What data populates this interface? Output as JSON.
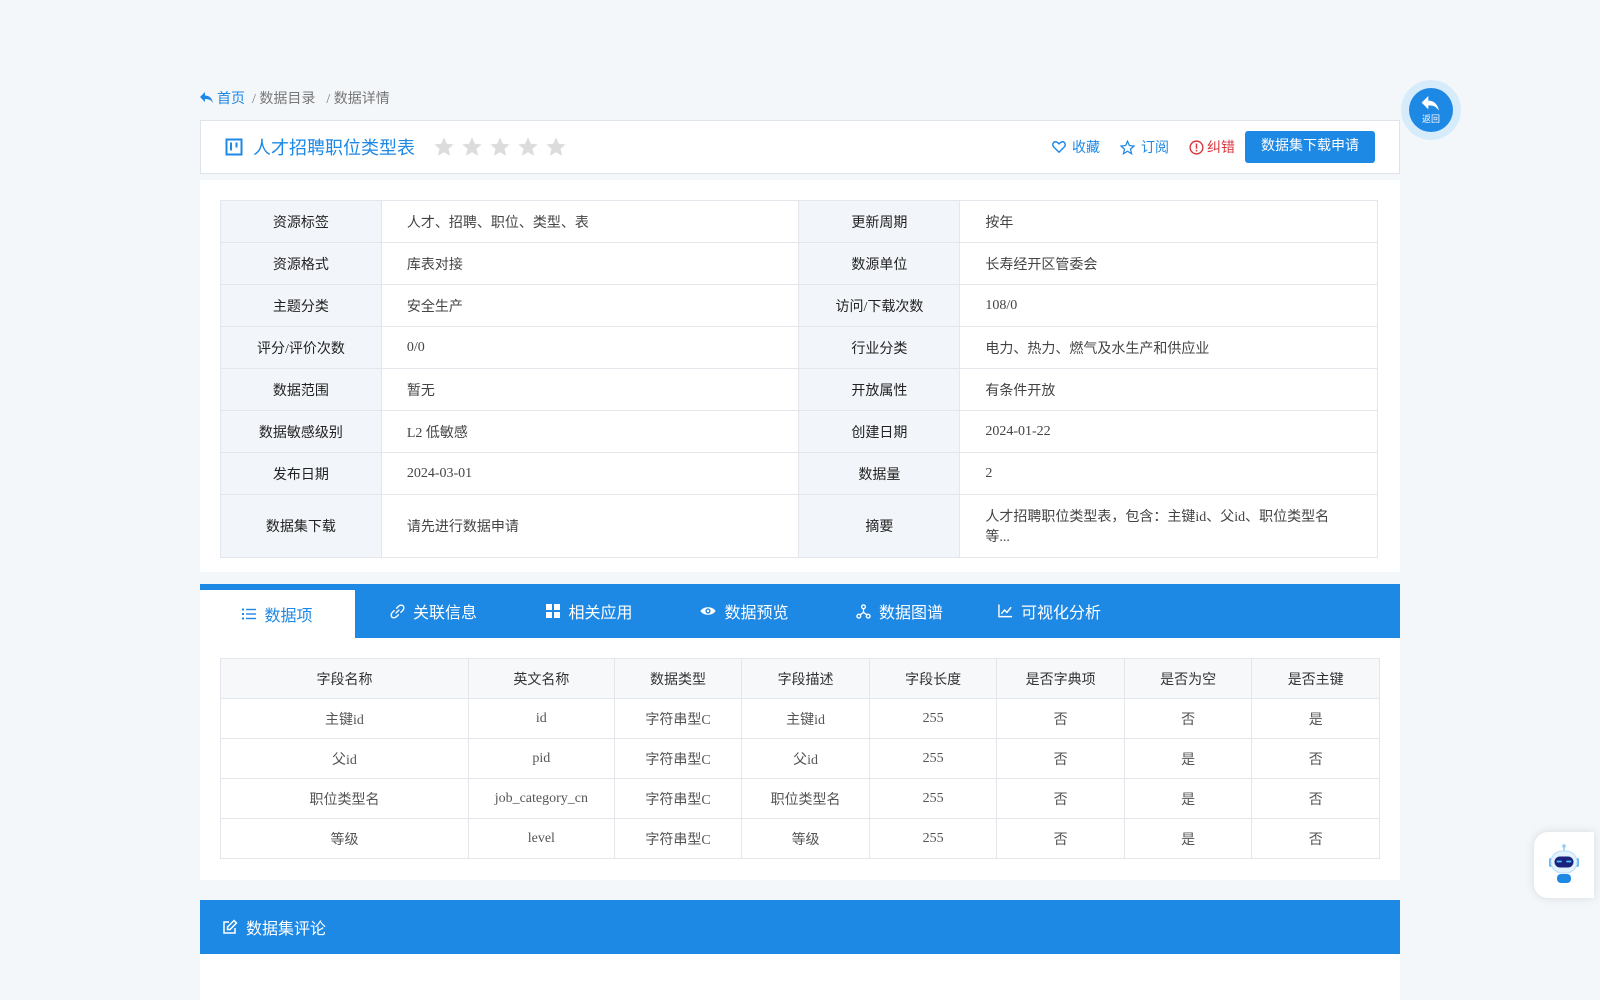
{
  "breadcrumb": {
    "home": "首页",
    "catalog": "/ 数据目录",
    "detail": "/ 数据详情"
  },
  "title_bar": {
    "title": "人才招聘职位类型表",
    "rating_stars": 0,
    "rating_max": 5,
    "favorite": "收藏",
    "subscribe": "订阅",
    "report": "纠错",
    "apply_download": "数据集下载申请"
  },
  "info": {
    "rows": [
      [
        {
          "label": "资源标签",
          "value": "人才、招聘、职位、类型、表"
        },
        {
          "label": "更新周期",
          "value": "按年"
        }
      ],
      [
        {
          "label": "资源格式",
          "value": "库表对接"
        },
        {
          "label": "数源单位",
          "value": "长寿经开区管委会"
        }
      ],
      [
        {
          "label": "主题分类",
          "value": "安全生产"
        },
        {
          "label": "访问/下载次数",
          "value": "108/0"
        }
      ],
      [
        {
          "label": "评分/评价次数",
          "value": "0/0"
        },
        {
          "label": "行业分类",
          "value": "电力、热力、燃气及水生产和供应业"
        }
      ],
      [
        {
          "label": "数据范围",
          "value": "暂无"
        },
        {
          "label": "开放属性",
          "value": "有条件开放"
        }
      ],
      [
        {
          "label": "数据敏感级别",
          "value": "L2 低敏感"
        },
        {
          "label": "创建日期",
          "value": "2024-01-22"
        }
      ],
      [
        {
          "label": "发布日期",
          "value": "2024-03-01"
        },
        {
          "label": "数据量",
          "value": "2"
        }
      ],
      [
        {
          "label": "数据集下载",
          "value": "请先进行数据申请"
        },
        {
          "label": "摘要",
          "value": "人才招聘职位类型表，包含：主键id、父id、职位类型名等..."
        }
      ]
    ]
  },
  "tabs": [
    {
      "label": "数据项",
      "icon": "list-icon"
    },
    {
      "label": "关联信息",
      "icon": "link-icon"
    },
    {
      "label": "相关应用",
      "icon": "apps-grid-icon"
    },
    {
      "label": "数据预览",
      "icon": "eye-icon"
    },
    {
      "label": "数据图谱",
      "icon": "graph-icon"
    },
    {
      "label": "可视化分析",
      "icon": "line-chart-icon"
    }
  ],
  "fields": {
    "headers": [
      "字段名称",
      "英文名称",
      "数据类型",
      "字段描述",
      "字段长度",
      "是否字典项",
      "是否为空",
      "是否主键"
    ],
    "rows": [
      [
        "主键id",
        "id",
        "字符串型C",
        "主键id",
        "255",
        "否",
        "否",
        "是"
      ],
      [
        "父id",
        "pid",
        "字符串型C",
        "父id",
        "255",
        "否",
        "是",
        "否"
      ],
      [
        "职位类型名",
        "job_category_cn",
        "字符串型C",
        "职位类型名",
        "255",
        "否",
        "是",
        "否"
      ],
      [
        "等级",
        "level",
        "字符串型C",
        "等级",
        "255",
        "否",
        "是",
        "否"
      ]
    ]
  },
  "comments": {
    "title": "数据集评论"
  },
  "floating": {
    "back_label": "返回"
  },
  "colors": {
    "primary": "#1e88e5",
    "danger": "#d9363e",
    "star": "#dcdcdc"
  }
}
